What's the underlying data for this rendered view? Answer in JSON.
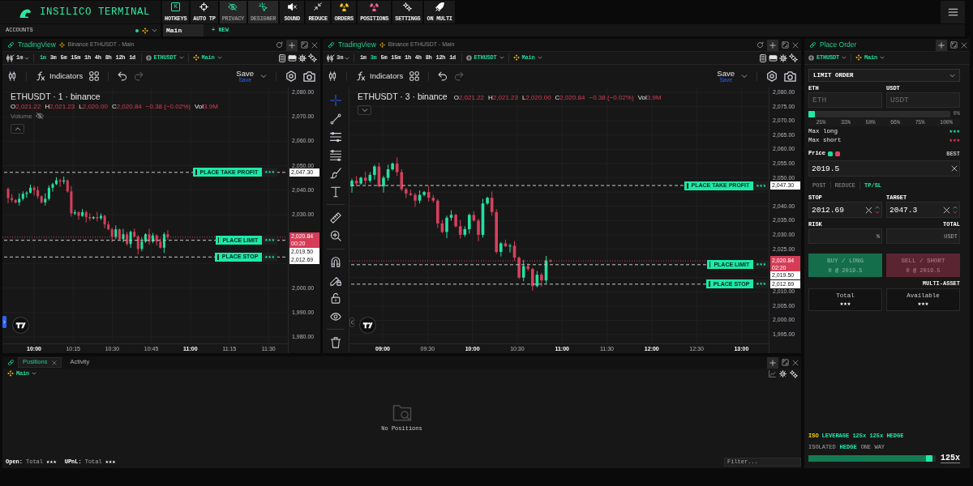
{
  "header": {
    "title": "INSILICO TERMINAL"
  },
  "toolbar": [
    {
      "kind": "hotkeys",
      "label": "HOTKEYS",
      "glyph": "K",
      "on": false
    },
    {
      "kind": "autotp",
      "label": "AUTO TP",
      "on": false
    },
    {
      "kind": "privacy",
      "label": "PRIVACY",
      "on": true
    },
    {
      "kind": "designer",
      "label": "DESIGNER",
      "on": true
    },
    {
      "kind": "sound",
      "label": "SOUND",
      "on": false
    },
    {
      "kind": "reduce",
      "label": "REDUCE",
      "on": false
    },
    {
      "kind": "orders",
      "label": "ORDERS",
      "on": false
    },
    {
      "kind": "positions",
      "label": "POSITIONS",
      "on": false
    },
    {
      "kind": "settings",
      "label": "SETTINGS",
      "on": false
    },
    {
      "kind": "multi",
      "label": "ON MULTI",
      "on": false
    }
  ],
  "accounts": {
    "label": "ACCOUNTS",
    "tabs": [
      {
        "label": "Main",
        "selected": true
      }
    ],
    "new_button": "+ NEW"
  },
  "charts": [
    {
      "source": "TradingView",
      "subtitle": "Binance ETHUSDT - Main",
      "interval": "1m",
      "intervals": [
        {
          "label": "1m",
          "selected": true
        },
        {
          "label": "3m",
          "selected": false
        },
        {
          "label": "5m",
          "selected": false
        },
        {
          "label": "15m",
          "selected": false
        },
        {
          "label": "1h",
          "selected": false
        },
        {
          "label": "4h",
          "selected": false
        },
        {
          "label": "8h",
          "selected": false
        },
        {
          "label": "12h",
          "selected": false
        },
        {
          "label": "1d",
          "selected": false
        }
      ],
      "symbol": "ETHUSDT",
      "account": "Main",
      "indicators": "Indicators",
      "save": "Save",
      "save_hint": "Save",
      "legend": {
        "title": "ETHUSDT · 1 · binance",
        "values": [
          {
            "key": "O",
            "value": "2,021.22"
          },
          {
            "key": "H",
            "value": "2,021.23"
          },
          {
            "key": "L",
            "value": "2,020.00"
          },
          {
            "key": "C",
            "value": "2,020.84"
          }
        ],
        "change": "−0.38 (−0.02%)",
        "volume_key": "Vol",
        "volume_value": "3.9M"
      },
      "volume_study": "Volume",
      "price_ticks": [
        "2,080.00",
        "2,070.00",
        "2,060.00",
        "2,050.00",
        "2,040.00",
        "2,030.00",
        "2,000.00",
        "1,990.00",
        "1,980.00"
      ],
      "time_ticks": [
        {
          "label": "10:00",
          "major": true
        },
        {
          "label": "10:15",
          "major": false
        },
        {
          "label": "10:30",
          "major": false
        },
        {
          "label": "10:45",
          "major": false
        },
        {
          "label": "11:00",
          "major": true
        },
        {
          "label": "11:15",
          "major": false
        },
        {
          "label": "11:30",
          "major": false
        }
      ],
      "order_lines": [
        {
          "label": "PLACE TAKE PROFIT",
          "amount": "★★★",
          "price": "2,047.30"
        },
        {
          "label": "PLACE LIMIT",
          "amount": "★★★",
          "price": "2,019.50"
        },
        {
          "label": "PLACE STOP",
          "amount": "★★★",
          "price": "2,012.69"
        }
      ],
      "last_price": {
        "price": "2,020.84",
        "countdown": "00:20"
      }
    },
    {
      "source": "TradingView",
      "subtitle": "Binance ETHUSDT - Main",
      "interval": "3m",
      "intervals": [
        {
          "label": "1m",
          "selected": false
        },
        {
          "label": "3m",
          "selected": true
        },
        {
          "label": "5m",
          "selected": false
        },
        {
          "label": "15m",
          "selected": false
        },
        {
          "label": "1h",
          "selected": false
        },
        {
          "label": "4h",
          "selected": false
        },
        {
          "label": "8h",
          "selected": false
        },
        {
          "label": "12h",
          "selected": false
        },
        {
          "label": "1d",
          "selected": false
        }
      ],
      "symbol": "ETHUSDT",
      "account": "Main",
      "indicators": "Indicators",
      "save": "Save",
      "save_hint": "Save",
      "legend": {
        "title": "ETHUSDT · 3 · binance",
        "values": [
          {
            "key": "O",
            "value": "2,021.22"
          },
          {
            "key": "H",
            "value": "2,021.23"
          },
          {
            "key": "L",
            "value": "2,020.00"
          },
          {
            "key": "C",
            "value": "2,020.84"
          }
        ],
        "change": "−0.38 (−0.02%)",
        "volume_key": "Vol",
        "volume_value": "3.9M"
      },
      "drawing_tools": [
        {
          "kind": "crosshair",
          "selected": true
        },
        {
          "kind": "trend_line",
          "selected": false
        },
        {
          "kind": "horizontal_lines",
          "selected": false
        },
        {
          "kind": "fib",
          "selected": false
        },
        {
          "kind": "brush",
          "selected": false
        },
        {
          "kind": "text",
          "selected": false
        },
        {
          "kind": "ruler",
          "selected": false
        },
        {
          "kind": "zoom",
          "selected": false
        },
        {
          "kind": "magnet",
          "selected": false
        },
        {
          "kind": "lock_drawing",
          "selected": false
        },
        {
          "kind": "lock",
          "selected": false
        },
        {
          "kind": "visibility",
          "selected": false
        },
        {
          "kind": "trash",
          "selected": false
        }
      ],
      "price_ticks": [
        "2,080.00",
        "2,075.00",
        "2,070.00",
        "2,065.00",
        "2,060.00",
        "2,055.00",
        "2,050.00",
        "2,040.00",
        "2,035.00",
        "2,030.00",
        "2,025.00",
        "2,010.00",
        "2,005.00",
        "2,000.00",
        "1,995.00"
      ],
      "time_ticks": [
        {
          "label": "09:00",
          "major": true
        },
        {
          "label": "09:30",
          "major": false
        },
        {
          "label": "10:00",
          "major": true
        },
        {
          "label": "10:30",
          "major": false
        },
        {
          "label": "11:00",
          "major": true
        },
        {
          "label": "11:30",
          "major": false
        },
        {
          "label": "12:00",
          "major": true
        },
        {
          "label": "12:30",
          "major": false
        },
        {
          "label": "13:00",
          "major": true
        }
      ],
      "order_lines": [
        {
          "label": "PLACE TAKE PROFIT",
          "amount": "★★★",
          "price": "2,047.30"
        },
        {
          "label": "PLACE LIMIT",
          "amount": "★★★",
          "price": "2,019.50"
        },
        {
          "label": "PLACE STOP",
          "amount": "★★★",
          "price": "2,012.69"
        }
      ],
      "last_price": {
        "price": "2,020.84",
        "countdown": "02:20"
      }
    }
  ],
  "order_panel": {
    "title": "Place Order",
    "symbol": "ETHUSDT",
    "account": "Main",
    "order_type": "LIMIT ORDER",
    "amount_fields": [
      {
        "label": "ETH",
        "placeholder": "ETH"
      },
      {
        "label": "USDT",
        "placeholder": "USDT"
      }
    ],
    "size_slider": {
      "level": 0,
      "reading": "0%"
    },
    "size_presets": [
      "25%",
      "33%",
      "50%",
      "66%",
      "75%",
      "100%"
    ],
    "limits": [
      {
        "kind": "long",
        "label": "Max long",
        "value": "★★★"
      },
      {
        "kind": "short",
        "label": "Max short",
        "value": "★★★"
      }
    ],
    "price": {
      "label": "Price",
      "hint": "BEST",
      "value": "2019.5",
      "dots": [
        {
          "color": "#1fd99a"
        },
        {
          "color": "#e0435e"
        }
      ]
    },
    "options": [
      {
        "label": "POST",
        "selected": false
      },
      {
        "label": "REDUCE",
        "selected": false
      },
      {
        "label": "TP/SL",
        "selected": true
      }
    ],
    "stop": {
      "label": "STOP",
      "value": "2012.69"
    },
    "target": {
      "label": "TARGET",
      "value": "2047.3"
    },
    "risk": {
      "label": "RISK",
      "unit": "%"
    },
    "total": {
      "label": "TOTAL",
      "unit": "USDT"
    },
    "actions": [
      {
        "kind": "buy",
        "label": "BUY / LONG",
        "detail": "0 @ 2019.5"
      },
      {
        "kind": "sell",
        "label": "SELL / SHORT",
        "detail": "0 @ 2019.5"
      }
    ],
    "multi_asset": "MULTI-ASSET",
    "balances": [
      {
        "label": "Total",
        "value": "★★★"
      },
      {
        "label": "Available",
        "value": "★★★"
      }
    ],
    "margin_tag": "ISO",
    "leverage_summary": "LEVERAGE 125x 125x HEDGE",
    "margin_modes": [
      {
        "label": "ISOLATED",
        "selected": false
      },
      {
        "label": "HEDGE",
        "selected": true
      },
      {
        "label": "ONE WAY",
        "selected": false
      }
    ],
    "leverage_slider": {
      "level": 0.97,
      "reading": "125x"
    }
  },
  "positions_panel": {
    "tabs": [
      {
        "label": "Positions",
        "selected": true,
        "closable": true
      },
      {
        "label": "Activity",
        "selected": false,
        "closable": false
      }
    ],
    "account": "Main",
    "empty_text": "No Positions",
    "footer": [
      {
        "label": "Open:",
        "key": "Total",
        "value": "★★★"
      },
      {
        "label": "UPnL:",
        "key": "Total",
        "value": "★★★"
      }
    ],
    "filter": {
      "placeholder": "Filter..."
    }
  }
}
